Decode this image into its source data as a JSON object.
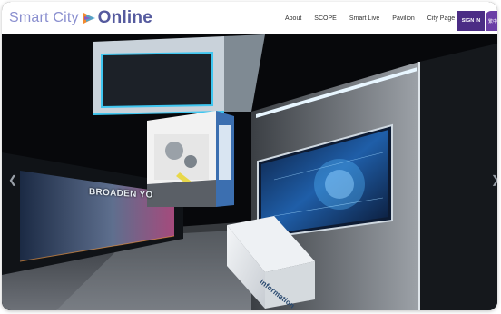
{
  "header": {
    "logo_part1": "Smart City",
    "logo_part2": "Online",
    "nav": [
      "About",
      "SCOPE",
      "Smart Live",
      "Pavilion",
      "City Page"
    ],
    "signin_label": "SIGN IN",
    "lang_label": "繁中"
  },
  "scene": {
    "banner_text": "BROADEN YO",
    "info_desk_text": "Information"
  },
  "icons": {
    "logo_mark": "play-logo-icon",
    "left_arrow": "chevron-left-icon",
    "right_arrow": "chevron-right-icon"
  },
  "colors": {
    "brand_purple": "#4b2d85",
    "logo_light": "#8a8fcf",
    "logo_dark": "#555a9e",
    "neon_cyan": "#3fc6f0"
  }
}
